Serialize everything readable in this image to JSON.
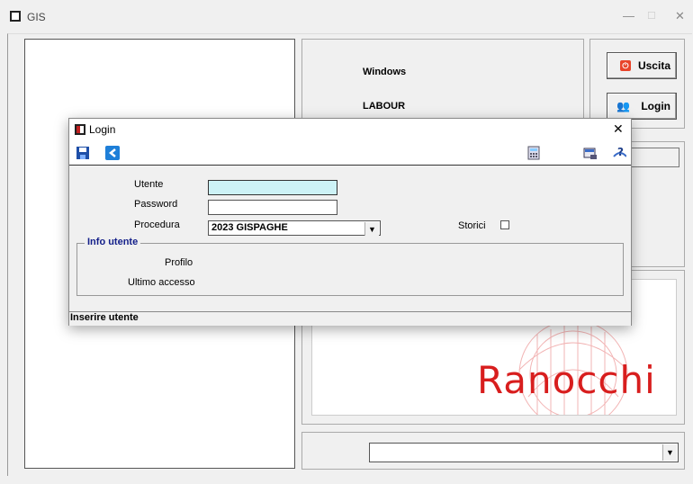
{
  "window": {
    "title": "GIS",
    "minimize": "—",
    "maximize": "☐",
    "close": "✕"
  },
  "info": {
    "line1": "Windows",
    "line2": "LABOUR"
  },
  "buttons": {
    "exit_label": "Uscita",
    "login_label": "Login"
  },
  "logo": {
    "text": "Ranocchi",
    "color": "#d81e1e"
  },
  "bottom_combo": {
    "value": ""
  },
  "dialog": {
    "title": "Login",
    "close": "✕",
    "toolbar": {
      "save_icon": "save-icon",
      "back_icon": "back-arrow-icon",
      "calc_icon": "calculator-icon",
      "print_icon": "printer-icon",
      "help_icon": "help-icon"
    },
    "fields": {
      "user_label": "Utente",
      "user_value": "",
      "password_label": "Password",
      "password_value": "",
      "procedure_label": "Procedura",
      "procedure_value": "2023 GISPAGHE",
      "historic_label": "Storici"
    },
    "user_info": {
      "legend": "Info utente",
      "profile_label": "Profilo",
      "last_access_label": "Ultimo accesso"
    },
    "status": "Inserire utente"
  }
}
